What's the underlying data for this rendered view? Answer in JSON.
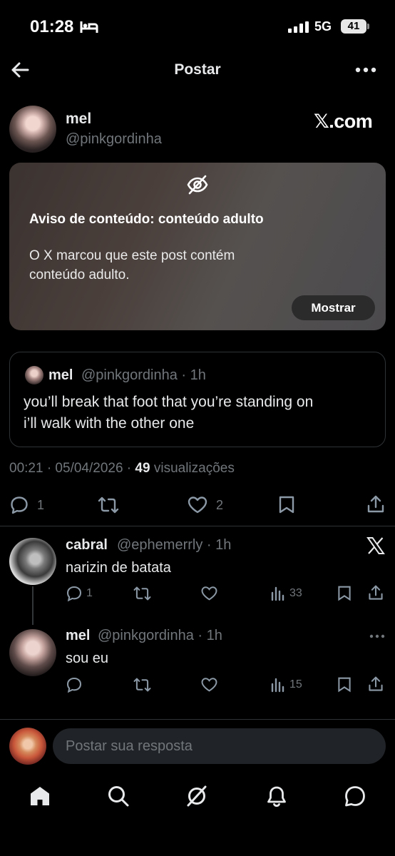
{
  "status_bar": {
    "time": "01:28",
    "network": "5G",
    "battery": "41"
  },
  "header": {
    "title": "Postar"
  },
  "post": {
    "author": {
      "name": "mel",
      "handle": "@pinkgordinha"
    },
    "source_badge": "𝕏.com",
    "content_warning": {
      "title": "Aviso de conteúdo: conteúdo adulto",
      "body": "O X marcou que este post contém conteúdo adulto.",
      "button": "Mostrar"
    },
    "quote": {
      "name": "mel",
      "handle_time": "@pinkgordinha · 1h",
      "text_line1": "you’ll break that foot that you’re standing on",
      "text_line2": "i’ll walk with the other one"
    },
    "meta": {
      "time_date": "00:21 · 05/04/2026 · ",
      "views": "49",
      "views_label": " visualizações"
    },
    "actions": {
      "replies": "1",
      "likes": "2"
    }
  },
  "replies": [
    {
      "name": "cabral",
      "handle_time": "@ephemerrly · 1h",
      "text": "narizin de batata",
      "replies": "1",
      "views": "33"
    },
    {
      "name": "mel",
      "handle_time": "@pinkgordinha · 1h",
      "text": "sou eu",
      "views": "15"
    }
  ],
  "composer": {
    "placeholder": "Postar sua resposta"
  },
  "bottom_nav": [
    "home-icon",
    "search-icon",
    "grok-icon",
    "notifications-icon",
    "messages-icon"
  ]
}
